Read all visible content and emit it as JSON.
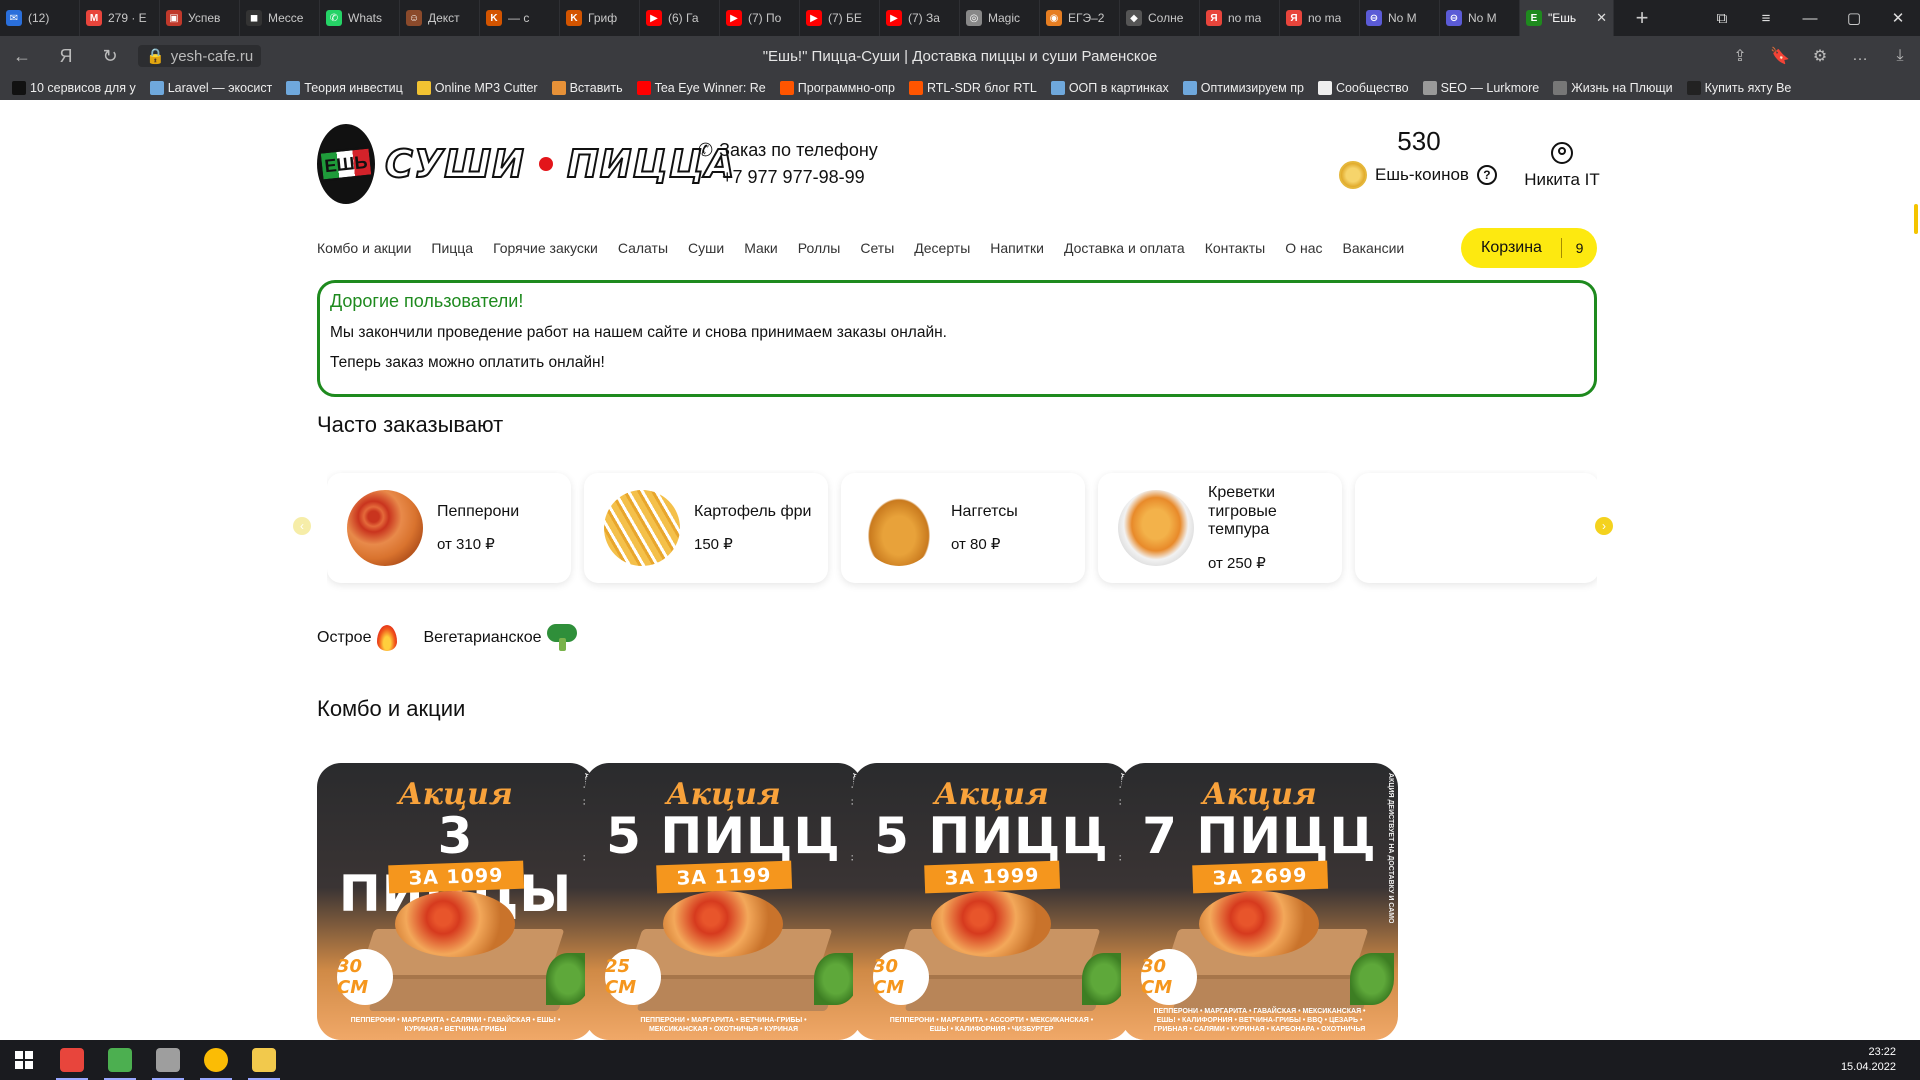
{
  "browser": {
    "tabs": [
      {
        "title": "(12)",
        "color": "#2a6fdb",
        "glyph": "✉"
      },
      {
        "title": "279 · E",
        "color": "#e8453c",
        "glyph": "M"
      },
      {
        "title": "Успев",
        "color": "#c0392b",
        "glyph": "▣"
      },
      {
        "title": "Мессе",
        "color": "#333333",
        "glyph": "◼"
      },
      {
        "title": "Whats",
        "color": "#25d366",
        "glyph": "✆"
      },
      {
        "title": "Декст",
        "color": "#8b4a2b",
        "glyph": "☺"
      },
      {
        "title": "— с",
        "color": "#d35400",
        "glyph": "K"
      },
      {
        "title": "Гриф",
        "color": "#d35400",
        "glyph": "K"
      },
      {
        "title": "(6) Га",
        "color": "#ff0000",
        "glyph": "▶"
      },
      {
        "title": "(7) По",
        "color": "#ff0000",
        "glyph": "▶"
      },
      {
        "title": "(7) БЕ",
        "color": "#ff0000",
        "glyph": "▶"
      },
      {
        "title": "(7) За",
        "color": "#ff0000",
        "glyph": "▶"
      },
      {
        "title": "Magic",
        "color": "#888888",
        "glyph": "◎"
      },
      {
        "title": "ЕГЭ–2",
        "color": "#e67e22",
        "glyph": "◉"
      },
      {
        "title": "Солне",
        "color": "#555555",
        "glyph": "◆"
      },
      {
        "title": "no ma",
        "color": "#e8453c",
        "glyph": "Я"
      },
      {
        "title": "no ma",
        "color": "#e8453c",
        "glyph": "Я"
      },
      {
        "title": "No M",
        "color": "#5b5bd6",
        "glyph": "⊖"
      },
      {
        "title": "No M",
        "color": "#5b5bd6",
        "glyph": "⊖"
      },
      {
        "title": "\"Ешь",
        "color": "#1e8a1e",
        "glyph": "Е",
        "active": true
      }
    ],
    "url": "yesh-cafe.ru",
    "page_title": "\"Ешь!\" Пицца-Суши | Доставка пиццы и суши Раменское",
    "bookmarks": [
      {
        "label": "10 сервисов для у",
        "color": "#111111"
      },
      {
        "label": "Laravel — экосист",
        "color": "#6fa8dc"
      },
      {
        "label": "Теория инвестиц",
        "color": "#6fa8dc"
      },
      {
        "label": "Online MP3 Cutter",
        "color": "#f1c232"
      },
      {
        "label": "Вставить",
        "color": "#e69138"
      },
      {
        "label": "Tea Eye Winner: Re",
        "color": "#ff0000"
      },
      {
        "label": "Программно-опр",
        "color": "#ff5500"
      },
      {
        "label": "RTL-SDR блог RTL",
        "color": "#ff5500"
      },
      {
        "label": "ООП в картинках",
        "color": "#6fa8dc"
      },
      {
        "label": "Оптимизируем пр",
        "color": "#6fa8dc"
      },
      {
        "label": "Сообщество",
        "color": "#eeeeee"
      },
      {
        "label": "SEO — Lurkmore",
        "color": "#999999"
      },
      {
        "label": "Жизнь на Плющи",
        "color": "#777777"
      },
      {
        "label": "Купить яхту Be",
        "color": "#222222"
      }
    ]
  },
  "site": {
    "logo_text_left": "СУШИ",
    "logo_text_right": "ПИЦЦА",
    "logo_badge": "ЕШЬ",
    "phone_label": "Заказ по телефону",
    "phone_number": "+7 977 977-98-99",
    "coins_amount": "530",
    "coins_label": "Ешь-коинов",
    "user_name": "Никита IT",
    "menu": [
      "Комбо и акции",
      "Пицца",
      "Горячие закуски",
      "Салаты",
      "Суши",
      "Маки",
      "Роллы",
      "Сеты",
      "Десерты",
      "Напитки",
      "Доставка и оплата",
      "Контакты",
      "О нас",
      "Вакансии"
    ],
    "cart_label": "Корзина",
    "cart_count": "9",
    "notice_title": "Дорогие пользователи!",
    "notice_line1": "Мы закончили проведение работ на нашем сайте и снова принимаем заказы онлайн.",
    "notice_line2": "Теперь заказ можно оплатить онлайн!",
    "popular_title": "Часто заказывают",
    "popular": [
      {
        "name": "Пепперони",
        "price": "от 310 ₽",
        "icon": "pepperoni-pizza"
      },
      {
        "name": "Картофель фри",
        "price": "150 ₽",
        "icon": "french-fries"
      },
      {
        "name": "Наггетсы",
        "price": "от 80 ₽",
        "icon": "nuggets"
      },
      {
        "name": "Креветки тигровые темпура",
        "price": "от 250 ₽",
        "icon": "tempura-shrimp"
      }
    ],
    "filter_spicy": "Острое",
    "filter_veg": "Вегетарианское",
    "combo_title": "Комбо и акции",
    "promos": [
      {
        "akcia": "Акция",
        "big": "3 ПИЦЦЫ",
        "price": "ЗА 1099",
        "size": "30 СМ",
        "side": "АКЦИЯ ДЕЙСТВУЕТ НА ДОСТАВКУ И САМОВЫВОЗ",
        "list": "ПЕППЕРОНИ • МАРГАРИТА • САЛЯМИ • ГАВАЙСКАЯ • ЕШЬ! • КУРИНАЯ • ВЕТЧИНА-ГРИБЫ"
      },
      {
        "akcia": "Акция",
        "big": "5 ПИЦЦ",
        "price": "ЗА 1199",
        "size": "25 СМ",
        "side": "АКЦИЯ ДЕЙСТВУЕТ НА ДОСТАВКУ И САМОВЫВОЗ",
        "list": "ПЕППЕРОНИ • МАРГАРИТА • ВЕТЧИНА-ГРИБЫ • МЕКСИКАНСКАЯ • ОХОТНИЧЬЯ • КУРИНАЯ"
      },
      {
        "akcia": "Акция",
        "big": "5 ПИЦЦ",
        "price": "ЗА 1999",
        "size": "30 СМ",
        "side": "АКЦИЯ ДЕЙСТВУЕТ НА ДОСТАВКУ И САМОВЫВОЗ",
        "list": "ПЕППЕРОНИ • МАРГАРИТА • АССОРТИ • МЕКСИКАНСКАЯ • ЕШЬ! • КАЛИФОРНИЯ • ЧИЗБУРГЕР"
      },
      {
        "akcia": "Акция",
        "big": "7 ПИЦЦ",
        "price": "ЗА 2699",
        "size": "30 СМ",
        "side": "АКЦИЯ ДЕЙСТВУЕТ НА ДОСТАВКУ И САМОВЫВОЗ",
        "list": "ПЕППЕРОНИ • МАРГАРИТА • ГАВАЙСКАЯ • МЕКСИКАНСКАЯ • ЕШЬ! • КАЛИФОРНИЯ • ВЕТЧИНА-ГРИБЫ • BBQ • ЦЕЗАРЬ • ГРИБНАЯ • САЛЯМИ • КУРИНАЯ • КАРБОНАРА • ОХОТНИЧЬЯ"
      }
    ]
  },
  "taskbar": {
    "time": "23:22",
    "date": "15.04.2022",
    "apps": [
      {
        "name": "yandex-browser",
        "color": "#e8453c"
      },
      {
        "name": "app-green",
        "color": "#4caf50"
      },
      {
        "name": "app-gray",
        "color": "#9e9e9e"
      },
      {
        "name": "chrome",
        "color": "#fbbc05"
      },
      {
        "name": "file-explorer",
        "color": "#f2c94c"
      }
    ]
  }
}
